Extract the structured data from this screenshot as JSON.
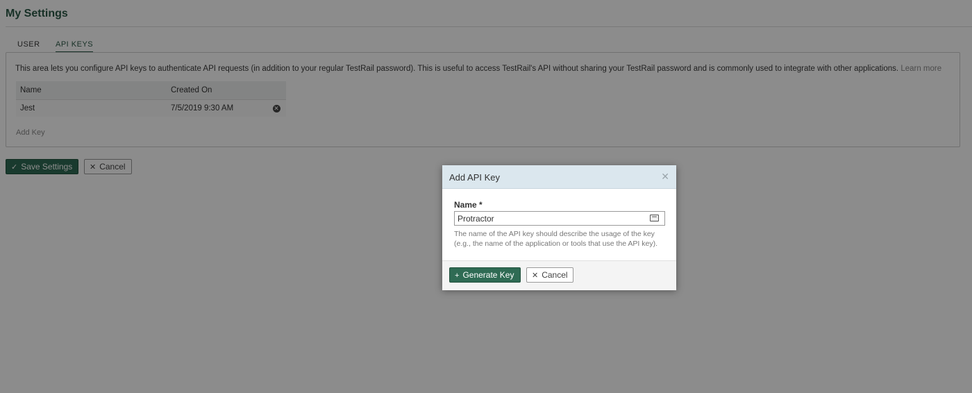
{
  "page": {
    "title": "My Settings"
  },
  "tabs": [
    {
      "label": "USER"
    },
    {
      "label": "API KEYS"
    }
  ],
  "api_keys": {
    "info": "This area lets you configure API keys to authenticate API requests (in addition to your regular TestRail password). This is useful to access TestRail's API without sharing your TestRail password and is commonly used to integrate with other applications.",
    "learn_more": "Learn more",
    "columns": {
      "name": "Name",
      "created": "Created On"
    },
    "rows": [
      {
        "name": "Jest",
        "created": "7/5/2019 9:30 AM"
      }
    ],
    "add_key": "Add Key"
  },
  "actions": {
    "save_label": "Save Settings",
    "cancel_label": "Cancel"
  },
  "dialog": {
    "title": "Add API Key",
    "name_label": "Name *",
    "name_value": "Protractor",
    "help_line1": "The name of the API key should describe the usage of the key",
    "help_line2": "(e.g., the name of the application or tools that use the API key).",
    "generate_label": "Generate Key",
    "cancel_label": "Cancel"
  },
  "icons": {
    "check": "check-icon",
    "cross": "x-icon",
    "plus": "plus-icon",
    "delete": "delete-circle-icon",
    "close": "close-icon",
    "input": "keyboard-icon"
  },
  "colors": {
    "brand": "#2c5a48",
    "primary_button": "#2f6b54",
    "dialog_header": "#dbe7ee",
    "overlay": "rgba(0,0,0,0.45)"
  }
}
